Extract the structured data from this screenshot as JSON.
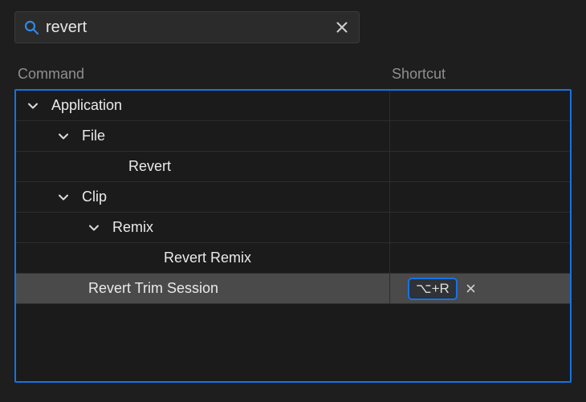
{
  "search": {
    "value": "revert"
  },
  "headers": {
    "command": "Command",
    "shortcut": "Shortcut"
  },
  "tree": {
    "application": {
      "label": "Application"
    },
    "file": {
      "label": "File"
    },
    "revert": {
      "label": "Revert"
    },
    "clip": {
      "label": "Clip"
    },
    "remix": {
      "label": "Remix"
    },
    "revert_remix": {
      "label": "Revert Remix"
    },
    "revert_trim": {
      "label": "Revert Trim Session",
      "shortcut": "⌥+R"
    }
  }
}
